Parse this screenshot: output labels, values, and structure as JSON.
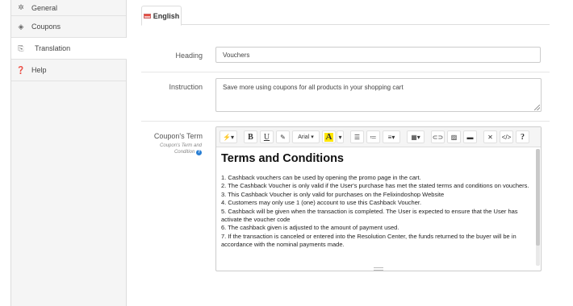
{
  "sidebar": {
    "items": [
      {
        "label": "General",
        "icon": "gear-icon"
      },
      {
        "label": "Coupons",
        "icon": "tag-icon"
      },
      {
        "label": "Translation",
        "icon": "translate-icon"
      },
      {
        "label": "Help",
        "icon": "help-icon"
      }
    ]
  },
  "tabs": [
    {
      "label": "English"
    }
  ],
  "form": {
    "heading_label": "Heading",
    "heading_value": "Vouchers",
    "instruction_label": "Instruction",
    "instruction_value": "Save more using coupons for all products in your shopping cart",
    "term_label": "Coupon's Term",
    "term_sublabel_1": "Coupon's Term and",
    "term_sublabel_2": "Condition"
  },
  "editor": {
    "toolbar": {
      "magic": "magic-wand-icon",
      "bold": "B",
      "underline": "U",
      "eraser": "eraser-icon",
      "font": "Arial",
      "color": "A",
      "help": "?"
    },
    "heading": "Terms and Conditions",
    "paragraphs": [
      "1. Cashback vouchers can be used by opening the promo page in the cart.",
      "2. The Cashback Voucher is only valid if the User's purchase has met the stated terms and conditions on vouchers.",
      "3. This Cashback Voucher is only valid for purchases on the Felixindoshop Website",
      "4. Customers may only use 1 (one) account to use this Cashback Voucher.",
      "5. Cashback will be given when the transaction is completed. The User is expected to ensure that the User has activate the voucher code",
      "6. The cashback given is adjusted to the amount of payment used.",
      "7. If the transaction is canceled or entered into the Resolution Center, the funds returned to the buyer will be in accordance with the nominal payments made."
    ]
  },
  "colors": {
    "accent": "#2a7fd4",
    "highlight": "#ffe600",
    "flag": "#e74c3c"
  }
}
